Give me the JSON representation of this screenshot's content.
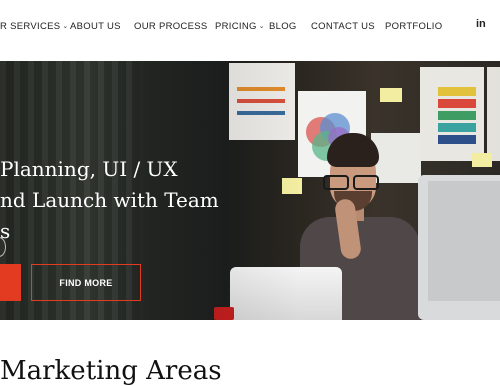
{
  "nav": {
    "items": [
      {
        "label": "R SERVICES",
        "dropdown": true
      },
      {
        "label": "ABOUT US",
        "dropdown": false
      },
      {
        "label": "OUR PROCESS",
        "dropdown": false
      },
      {
        "label": "PRICING",
        "dropdown": true
      },
      {
        "label": "BLOG",
        "dropdown": false
      },
      {
        "label": "CONTACT US",
        "dropdown": false
      },
      {
        "label": "PORTFOLIO",
        "dropdown": false
      }
    ],
    "social": "in"
  },
  "hero": {
    "headline_line1": "Planning, UI / UX",
    "headline_line2": "nd Launch with Team",
    "headline_line3": "s",
    "button_label": "FIND MORE",
    "accent_color": "#e33a22"
  },
  "section": {
    "heading": "Marketing Areas"
  }
}
